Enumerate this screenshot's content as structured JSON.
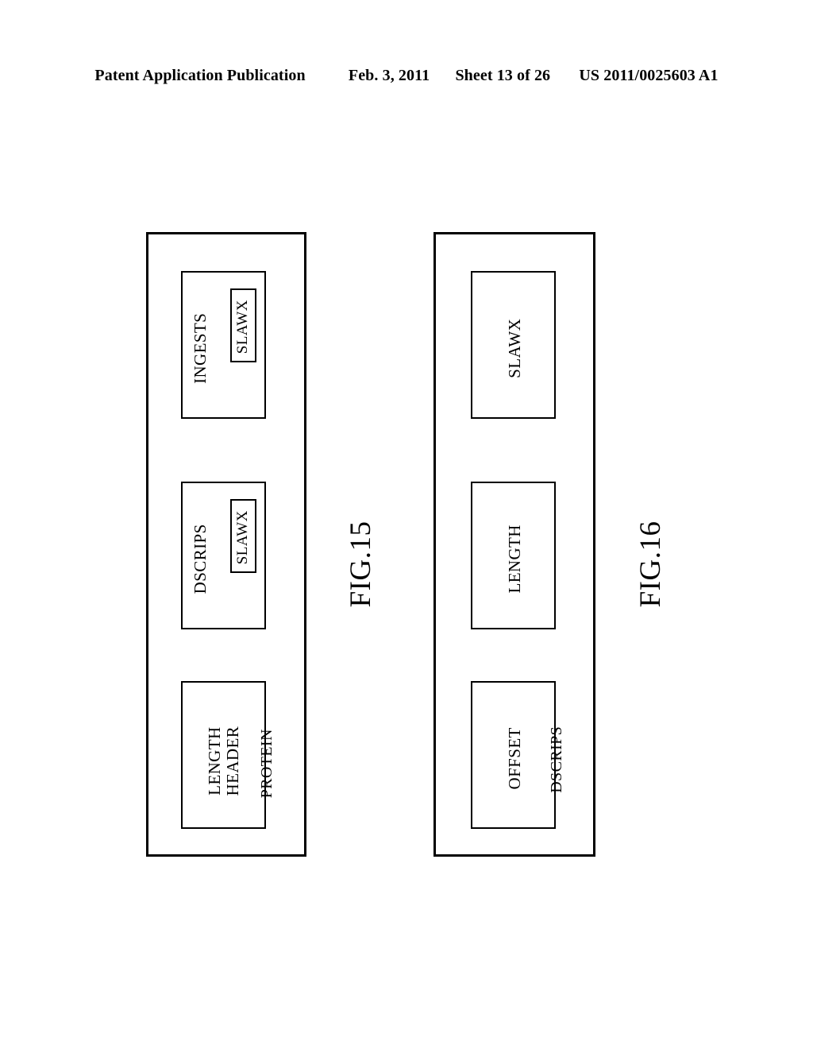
{
  "header": {
    "publication": "Patent Application Publication",
    "date": "Feb. 3, 2011",
    "sheet": "Sheet 13 of 26",
    "doc_number": "US 2011/0025603 A1"
  },
  "figures": [
    {
      "caption": "FIG.15",
      "container_label": "PROTEIN",
      "boxes": [
        {
          "label": "LENGTH\nHEADER",
          "nested": null
        },
        {
          "label": "DSCRIPS",
          "nested": "SLAWX"
        },
        {
          "label": "INGESTS",
          "nested": "SLAWX"
        }
      ]
    },
    {
      "caption": "FIG.16",
      "container_label": "DSCRIPS",
      "boxes": [
        {
          "label": "OFFSET",
          "nested": null
        },
        {
          "label": "LENGTH",
          "nested": null
        },
        {
          "label": "SLAWX",
          "nested": null
        }
      ]
    }
  ],
  "colors": {
    "ink": "#000000",
    "paper": "#ffffff"
  }
}
